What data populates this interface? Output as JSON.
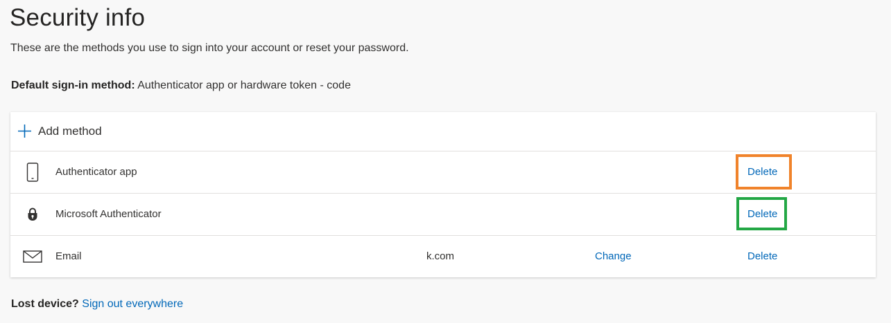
{
  "page": {
    "title": "Security info",
    "subtitle": "These are the methods you use to sign into your account or reset your password."
  },
  "default_method": {
    "label": "Default sign-in method:",
    "value": "Authenticator app or hardware token - code"
  },
  "add_method": {
    "label": "Add method",
    "icon": "plus-icon"
  },
  "methods": [
    {
      "name": "Authenticator app",
      "icon": "phone-icon",
      "detail": "",
      "change_label": "",
      "delete_label": "Delete"
    },
    {
      "name": "Microsoft Authenticator",
      "icon": "lock-icon",
      "detail": "",
      "change_label": "",
      "delete_label": "Delete"
    },
    {
      "name": "Email",
      "icon": "envelope-icon",
      "detail": "k.com",
      "change_label": "Change",
      "delete_label": "Delete"
    }
  ],
  "lost_device": {
    "label": "Lost device?",
    "link": "Sign out everywhere"
  },
  "colors": {
    "background": "#f8f8f8",
    "link": "#0067b8",
    "highlight_orange": "#f0832b",
    "highlight_green": "#23a745"
  }
}
